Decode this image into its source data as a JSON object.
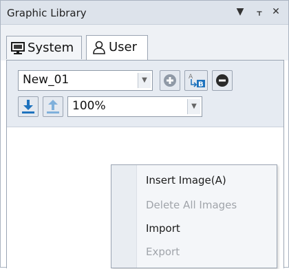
{
  "title": "Graphic Library",
  "title_buttons": {
    "dropdown": "▼",
    "pin": "ᚁ",
    "close": "✕"
  },
  "tabs": [
    {
      "label": "System",
      "icon": "monitor-icon",
      "active": false
    },
    {
      "label": "User",
      "icon": "user-icon",
      "active": true
    }
  ],
  "toolbar": {
    "library_select": {
      "value": "New_01"
    },
    "zoom_select": {
      "value": "100%"
    },
    "buttons": [
      {
        "name": "add-button",
        "icon": "plus-circle-icon"
      },
      {
        "name": "rename-button",
        "icon": "rename-ab-icon"
      },
      {
        "name": "remove-button",
        "icon": "minus-circle-icon"
      },
      {
        "name": "download-button",
        "icon": "download-icon"
      },
      {
        "name": "upload-button",
        "icon": "upload-icon"
      }
    ]
  },
  "context_menu": {
    "items": [
      {
        "label": "Insert Image(A)",
        "enabled": true
      },
      {
        "label": "Delete All Images",
        "enabled": false
      },
      {
        "label": "Import",
        "enabled": true
      },
      {
        "label": "Export",
        "enabled": false
      }
    ]
  },
  "colors": {
    "accent_blue": "#1e73be",
    "disabled_text": "#a0a4aa",
    "enabled_text": "#1a1a1a"
  }
}
